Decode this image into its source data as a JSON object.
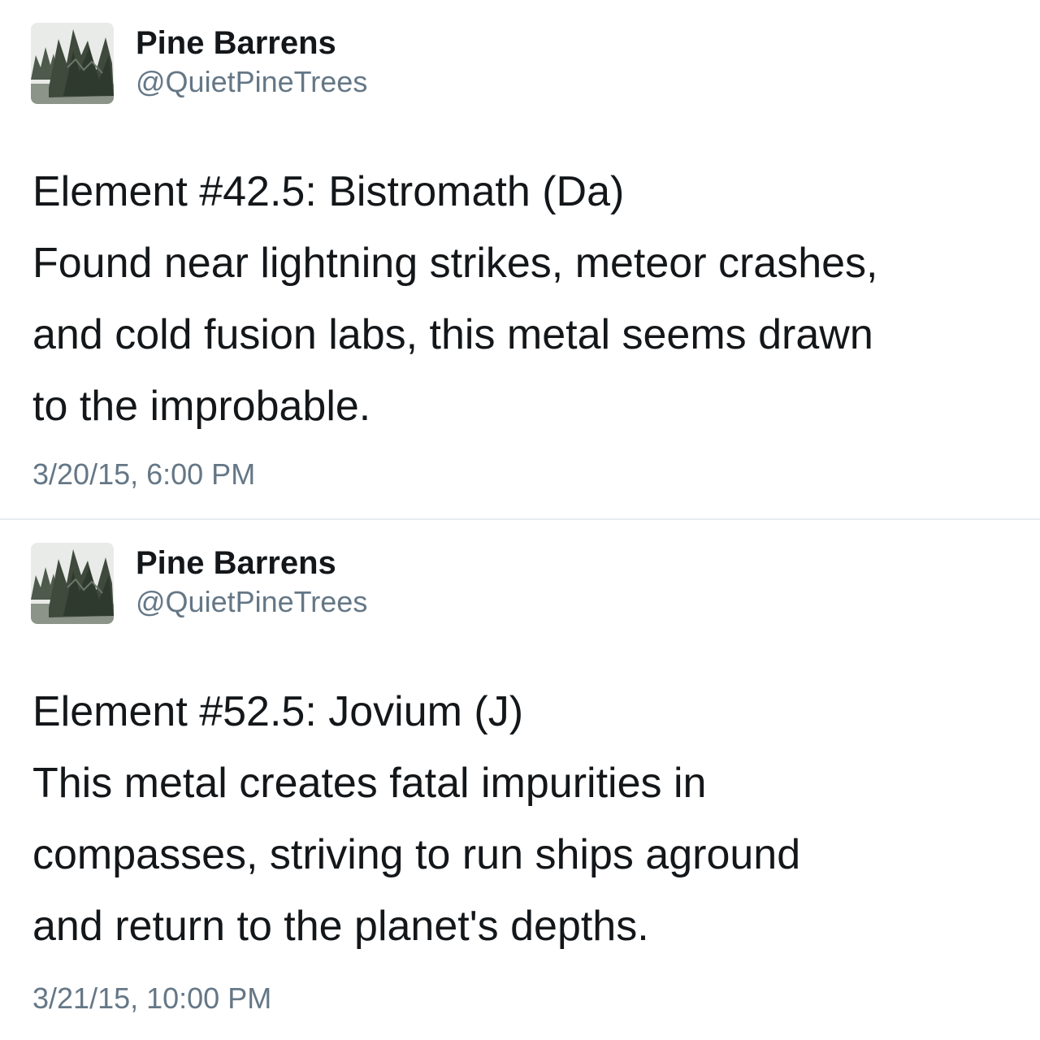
{
  "colors": {
    "text_primary": "#14171a",
    "text_secondary": "#657786",
    "divider": "#e6ecf0",
    "background": "#ffffff"
  },
  "tweets": [
    {
      "avatar_icon": "pine-trees-photo",
      "display_name": "Pine Barrens",
      "handle": "@QuietPineTrees",
      "text_lines": [
        "Element #42.5: Bistromath (Da)",
        "Found near lightning strikes, meteor crashes,",
        "and cold fusion labs, this metal seems drawn",
        "to the improbable."
      ],
      "timestamp": "3/20/15, 6:00 PM"
    },
    {
      "avatar_icon": "pine-trees-photo",
      "display_name": "Pine Barrens",
      "handle": "@QuietPineTrees",
      "text_lines": [
        "Element #52.5: Jovium (J)",
        "This metal creates fatal impurities in",
        "compasses, striving to run ships aground",
        "and return to the planet's depths."
      ],
      "timestamp": "3/21/15, 10:00 PM"
    }
  ]
}
